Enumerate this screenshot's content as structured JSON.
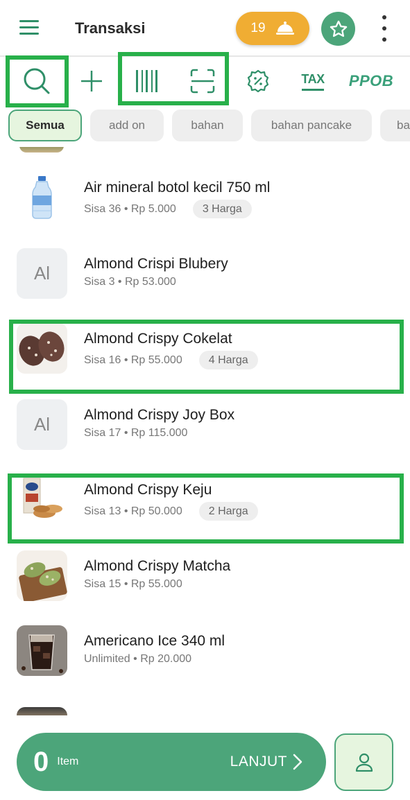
{
  "header": {
    "title": "Transaksi",
    "order_count": "19",
    "icons": {
      "menu": "hamburger-icon",
      "orders": "service-bell-icon",
      "favorite": "star-icon",
      "more": "more-vertical-icon"
    }
  },
  "toolbar": {
    "tax_label": "TAX",
    "ppob_label": "PPOB",
    "icons": [
      "search-icon",
      "plus-icon",
      "barcode-icon",
      "scan-icon",
      "discount-icon",
      "tax-icon",
      "ppob-logo"
    ]
  },
  "categories": [
    "Semua",
    "add on",
    "bahan",
    "bahan pancake",
    "ba"
  ],
  "products": [
    {
      "name": "Air mineral botol kecil 750 ml",
      "stock": "Sisa 36",
      "price": "Rp 5.000",
      "variants": "3 Harga",
      "thumb": "water-bottle"
    },
    {
      "name": "Almond Crispi Blubery",
      "stock": "Sisa 3",
      "price": "Rp 53.000",
      "variants": "",
      "initials": "Al"
    },
    {
      "name": "Almond Crispy Cokelat",
      "stock": "Sisa 16",
      "price": "Rp 55.000",
      "variants": "4 Harga",
      "thumb": "chocolate-cookie"
    },
    {
      "name": "Almond Crispy Joy Box",
      "stock": "Sisa 17",
      "price": "Rp 115.000",
      "variants": "",
      "initials": "Al"
    },
    {
      "name": "Almond Crispy Keju",
      "stock": "Sisa 13",
      "price": "Rp 50.000",
      "variants": "2 Harga",
      "thumb": "cheese-cookie"
    },
    {
      "name": "Almond Crispy Matcha",
      "stock": "Sisa 15",
      "price": "Rp 55.000",
      "variants": "",
      "thumb": "matcha-cookie"
    },
    {
      "name": "Americano Ice 340 ml",
      "stock": "Unlimited",
      "price": "Rp 20.000",
      "variants": "",
      "thumb": "iced-coffee"
    }
  ],
  "checkout": {
    "count": "0",
    "count_label": "Item",
    "next_label": "LANJUT"
  },
  "colors": {
    "primary": "#4ca57a",
    "accent_orange": "#f0ad33",
    "highlight": "#28b04a",
    "chip_active_bg": "#e6f5df"
  }
}
